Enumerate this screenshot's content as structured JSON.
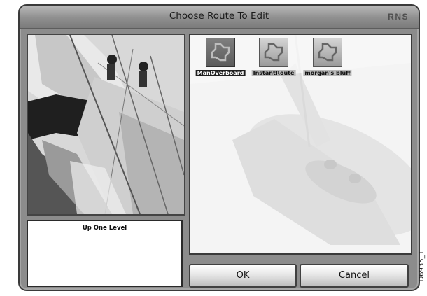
{
  "window": {
    "title": "Choose Route To Edit",
    "brand": "RNS"
  },
  "preview": {
    "label": "Up One Level"
  },
  "routes": [
    {
      "name": "ManOverboard",
      "selected": true,
      "icon": "route-icon"
    },
    {
      "name": "InstantRoute",
      "selected": false,
      "icon": "route-icon"
    },
    {
      "name": "morgan's bluff",
      "selected": false,
      "icon": "route-icon"
    }
  ],
  "buttons": {
    "ok": "OK",
    "cancel": "Cancel"
  },
  "figure_ref": "D6935_1"
}
